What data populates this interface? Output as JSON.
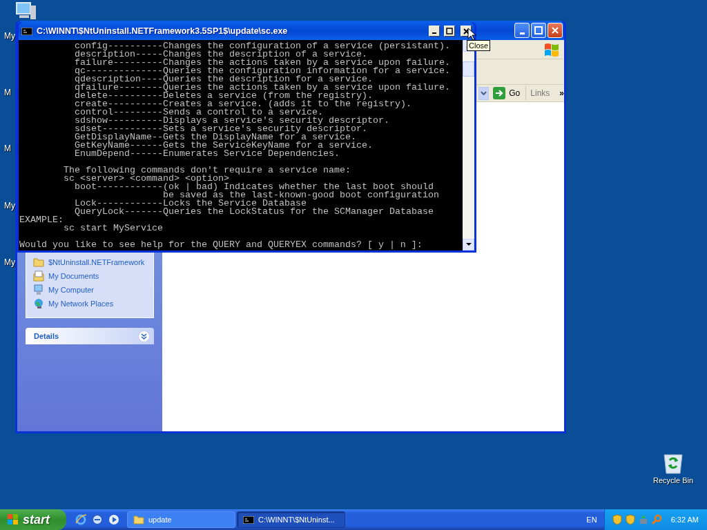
{
  "desktop_icons": [
    {
      "label": "My",
      "kind": "computer"
    },
    {
      "label": "M"
    },
    {
      "label": "M"
    },
    {
      "label": "My"
    },
    {
      "label": "My"
    }
  ],
  "explorer": {
    "address_bar": {
      "go": "Go",
      "links": "Links",
      "more": "»"
    },
    "other_places": [
      {
        "label": "$NtUninstall.NETFramework",
        "kind": "folder"
      },
      {
        "label": "My Documents",
        "kind": "documents"
      },
      {
        "label": "My Computer",
        "kind": "computer"
      },
      {
        "label": "My Network Places",
        "kind": "network"
      }
    ],
    "details": {
      "title": "Details"
    }
  },
  "console": {
    "title": "C:\\WINNT\\$NtUninstall.NETFramework3.5SP1$\\update\\sc.exe",
    "sections": [
      {
        "lines": [
          {
            "kind": "option",
            "text": "config----------Changes the configuration of a service (persistant)."
          },
          {
            "kind": "option",
            "text": "description-----Changes the description of a service."
          },
          {
            "kind": "option",
            "text": "failure---------Changes the actions taken by a service upon failure."
          },
          {
            "kind": "option",
            "text": "qc--------------Queries the configuration information for a service."
          },
          {
            "kind": "option",
            "text": "qdescription----Queries the description for a service."
          },
          {
            "kind": "option",
            "text": "qfailure--------Queries the actions taken by a service upon failure."
          },
          {
            "kind": "option",
            "text": "delete----------Deletes a service (from the registry)."
          },
          {
            "kind": "option",
            "text": "create----------Creates a service. (adds it to the registry)."
          },
          {
            "kind": "option",
            "text": "control---------Sends a control to a service."
          },
          {
            "kind": "option",
            "text": "sdshow----------Displays a service's security descriptor."
          },
          {
            "kind": "option",
            "text": "sdset-----------Sets a service's security descriptor."
          },
          {
            "kind": "option",
            "text": "GetDisplayName--Gets the DisplayName for a service."
          },
          {
            "kind": "option",
            "text": "GetKeyName------Gets the ServiceKeyName for a service."
          },
          {
            "kind": "option",
            "text": "EnumDepend------Enumerates Service Dependencies."
          }
        ]
      },
      {
        "lines": [
          {
            "kind": "note",
            "text": "The following commands don't require a service name:"
          },
          {
            "kind": "note",
            "text": "sc <server> <command> <option>"
          },
          {
            "kind": "option",
            "text": "boot------------(ok | bad) Indicates whether the last boot should"
          },
          {
            "kind": "continued",
            "text": "be saved as the last-known-good boot configuration"
          },
          {
            "kind": "option",
            "text": "Lock------------Locks the Service Database"
          },
          {
            "kind": "option",
            "text": "QueryLock-------Queries the LockStatus for the SCManager Database"
          },
          {
            "kind": "plain",
            "text": "EXAMPLE:"
          },
          {
            "kind": "note",
            "text": "sc start MyService"
          }
        ]
      },
      {
        "lines": [
          {
            "kind": "plain",
            "text": "Would you like to see help for the QUERY and QUERYEX commands? [ y | n ]:"
          }
        ]
      }
    ],
    "tooltip": "Close"
  },
  "recycle_bin": {
    "label": "Recycle Bin"
  },
  "taskbar": {
    "start": "start",
    "tasks": [
      {
        "label": "update",
        "kind": "folder",
        "selected": false
      },
      {
        "label": "C:\\WINNT\\$NtUninst...",
        "kind": "console",
        "selected": true
      }
    ],
    "language": "EN",
    "clock": "6:32 AM"
  }
}
